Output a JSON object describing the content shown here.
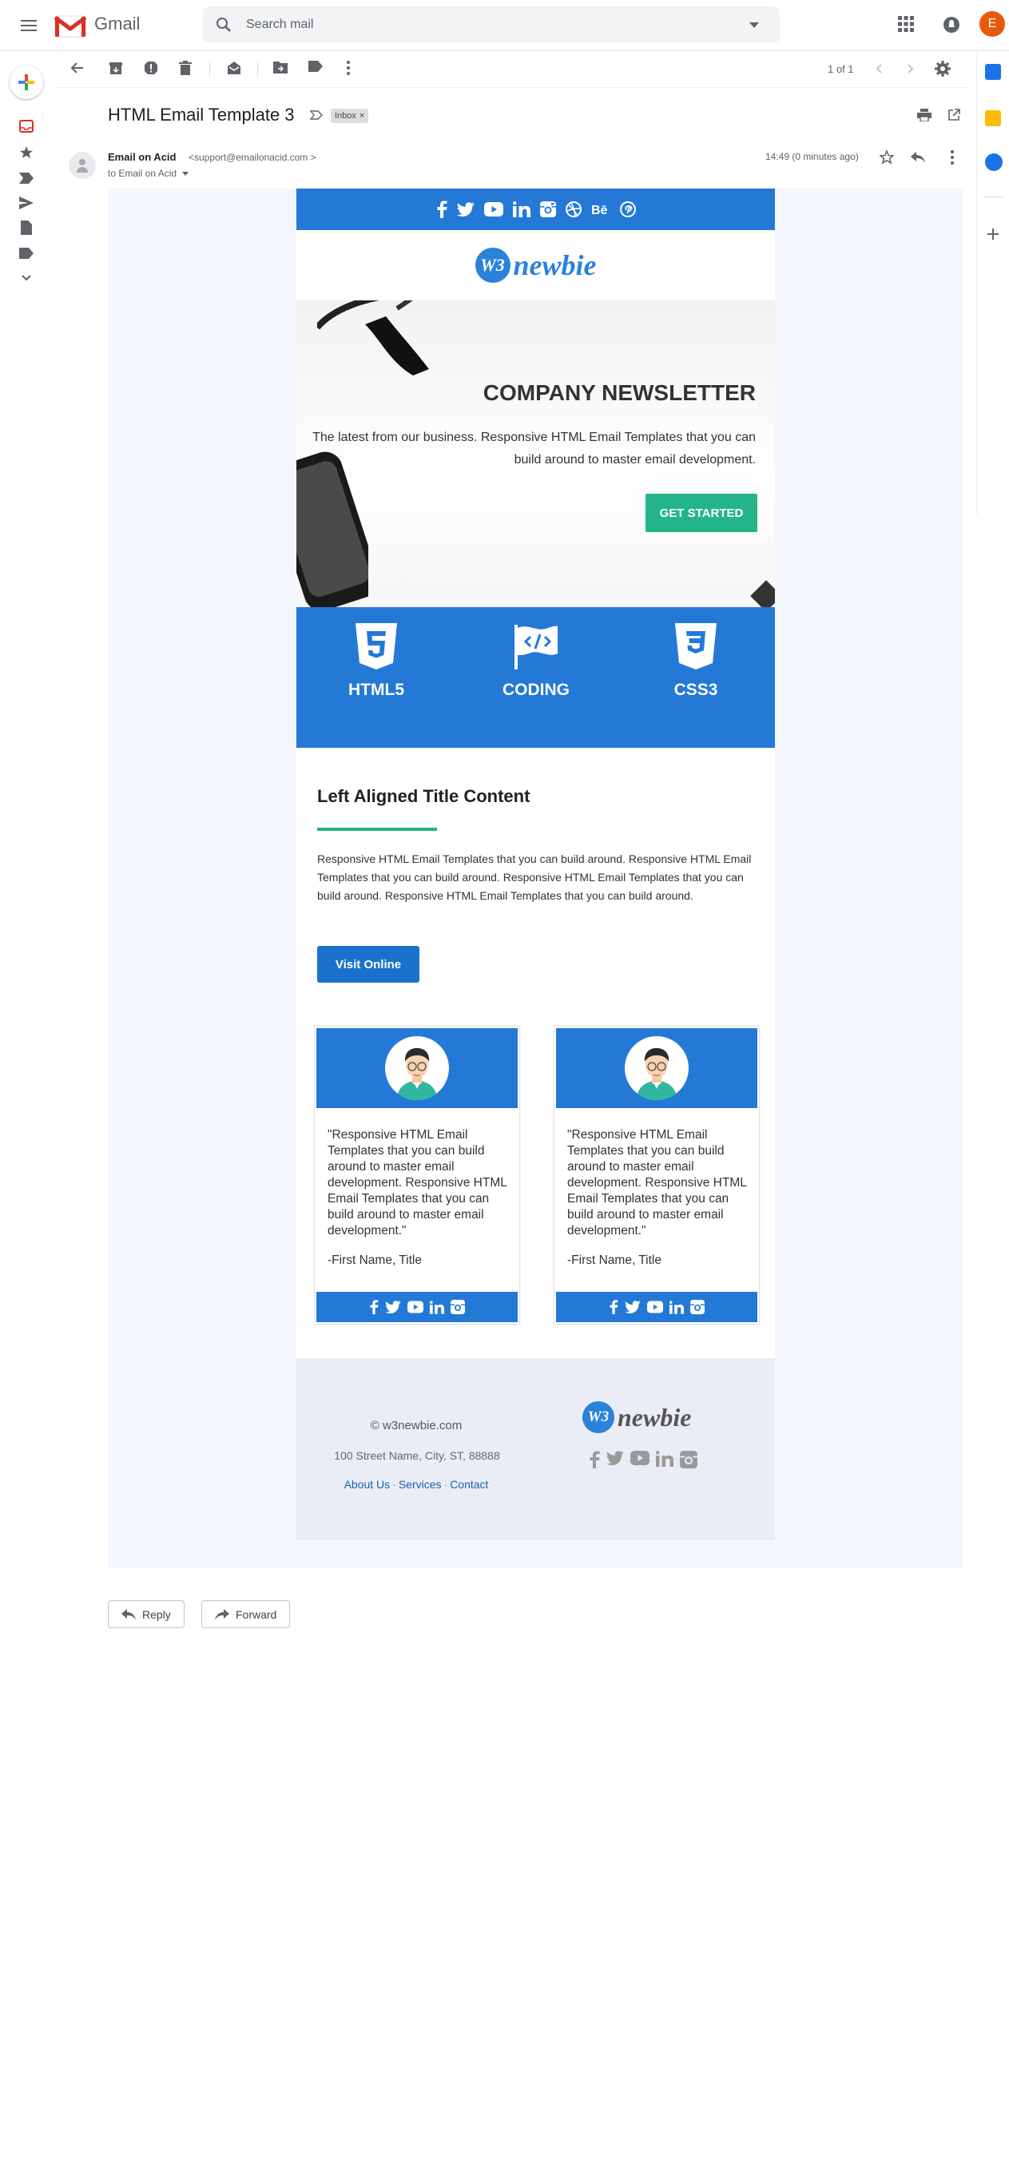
{
  "app": {
    "name": "Gmail",
    "user_initial": "E"
  },
  "search": {
    "placeholder": "Search mail"
  },
  "toolbar": {
    "pager": "1 of 1"
  },
  "message": {
    "subject": "HTML Email Template 3",
    "label_chip": "Inbox",
    "sender_name": "Email on Acid",
    "sender_email": "<support@emailonacid.com >",
    "to_line": "to Email on Acid",
    "time": "14:49 (0 minutes ago)"
  },
  "email": {
    "logo_mark": "W3",
    "logo_text": "newbie",
    "hero_title": "COMPANY NEWSLETTER",
    "hero_text": "The latest from our business. Responsive HTML Email Templates that you can build around to master email development.",
    "hero_button": "GET STARTED",
    "features": [
      {
        "label": "HTML5",
        "icon": "html5-icon"
      },
      {
        "label": "CODING",
        "icon": "code-flag-icon"
      },
      {
        "label": "CSS3",
        "icon": "css3-icon"
      }
    ],
    "section_title": "Left Aligned Title Content",
    "section_body": "Responsive HTML Email Templates that you can build around. Responsive HTML Email Templates that you can build around. Responsive HTML Email Templates that you can build around. Responsive HTML Email Templates that you can build around.",
    "visit_button": "Visit Online",
    "cards": [
      {
        "quote": "\"Responsive HTML Email Templates that you can build around to master email development. Responsive HTML Email Templates that you can build around to master email development.\"",
        "signature": "-First Name, Title"
      },
      {
        "quote": "\"Responsive HTML Email Templates that you can build around to master email development. Responsive HTML Email Templates that you can build around to master email development.\"",
        "signature": "-First Name, Title"
      }
    ],
    "footer": {
      "copyright": "© w3newbie.com",
      "address": "100 Street Name, City, ST, 88888",
      "links": [
        "About Us",
        "Services",
        "Contact"
      ]
    },
    "colors": {
      "brand_blue": "#2479d6",
      "accent_green": "#23b588"
    }
  },
  "actions": {
    "reply": "Reply",
    "forward": "Forward"
  }
}
